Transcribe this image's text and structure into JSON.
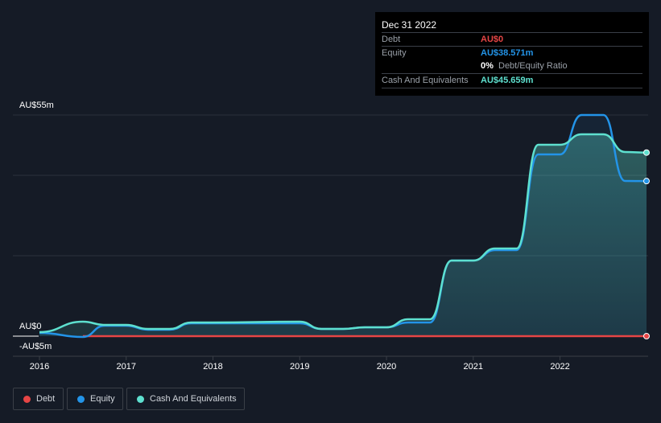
{
  "chart_data": {
    "type": "area",
    "yticks": [
      "AU$55m",
      "AU$0",
      "-AU$5m"
    ],
    "ylim": [
      -5,
      55
    ],
    "xticks": [
      "2016",
      "2017",
      "2018",
      "2019",
      "2020",
      "2021",
      "2022"
    ],
    "xlim": [
      2016,
      2023
    ],
    "grid": true,
    "legend_placement": "bottom-left",
    "series": [
      {
        "name": "Debt",
        "color": "#e64545",
        "x": [
          2016.5,
          2017,
          2018,
          2019,
          2020,
          2021,
          2022,
          2022.997
        ],
        "y": [
          0,
          0,
          0,
          0,
          0,
          0,
          0,
          0
        ]
      },
      {
        "name": "Equity",
        "color": "#2394e8",
        "x": [
          2016,
          2016.5,
          2016.75,
          2017,
          2017.25,
          2017.5,
          2017.75,
          2018,
          2019,
          2019.25,
          2019.5,
          2019.75,
          2020,
          2020.25,
          2020.5,
          2020.75,
          2021,
          2021.25,
          2021.5,
          2021.75,
          2022,
          2022.25,
          2022.5,
          2022.75,
          2022.997
        ],
        "y": [
          0.8,
          -0.2,
          2.6,
          2.6,
          1.6,
          1.6,
          3.2,
          3.2,
          3.2,
          1.8,
          1.8,
          2.2,
          2.2,
          3.4,
          3.4,
          18.8,
          18.8,
          21.4,
          21.4,
          45.2,
          45.2,
          55.0,
          55.0,
          38.6,
          38.571
        ]
      },
      {
        "name": "Cash And Equivalents",
        "color": "#5ee0cf",
        "x": [
          2016,
          2016.5,
          2016.75,
          2017,
          2017.25,
          2017.5,
          2017.75,
          2018,
          2019,
          2019.25,
          2019.5,
          2019.75,
          2020,
          2020.25,
          2020.5,
          2020.75,
          2021,
          2021.25,
          2021.5,
          2021.75,
          2022,
          2022.25,
          2022.5,
          2022.75,
          2022.997
        ],
        "y": [
          1.0,
          3.6,
          2.8,
          2.8,
          1.8,
          1.8,
          3.4,
          3.4,
          3.6,
          1.8,
          1.8,
          2.2,
          2.2,
          4.2,
          4.2,
          18.8,
          18.8,
          21.8,
          21.8,
          47.6,
          47.6,
          50.2,
          50.2,
          45.8,
          45.659
        ]
      }
    ]
  },
  "tooltip": {
    "date": "Dec 31 2022",
    "rows": [
      {
        "label": "Debt",
        "value": "AU$0",
        "color": "#e64545"
      },
      {
        "label": "Equity",
        "value": "AU$38.571m",
        "color": "#2394e8"
      },
      {
        "label": "",
        "value": "0%",
        "suffix": "Debt/Equity Ratio",
        "color": "#ffffff"
      },
      {
        "label": "Cash And Equivalents",
        "value": "AU$45.659m",
        "color": "#5ee0cf"
      }
    ]
  },
  "legend": [
    "Debt",
    "Equity",
    "Cash And Equivalents"
  ]
}
